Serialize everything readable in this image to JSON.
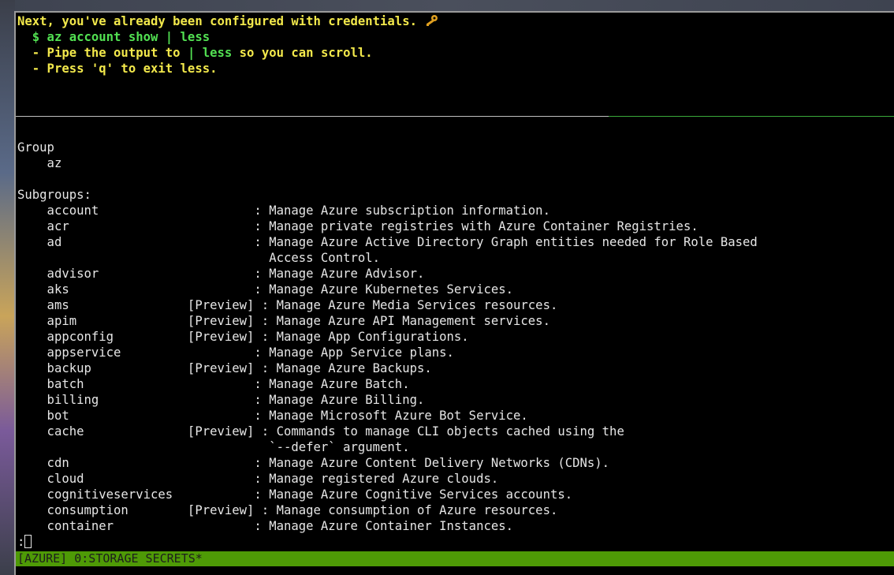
{
  "instructions": {
    "line1": "Next, you've already been configured with credentials.",
    "command": "  $ az account show | less",
    "note1_prefix": "  - Pipe the output to ",
    "note1_highlight": "| less",
    "note1_suffix": " so you can scroll.",
    "note2": "  - Press 'q' to exit less.",
    "line1_icon": "key-icon"
  },
  "help": {
    "group_header": "Group",
    "group_name": "    az",
    "subgroups_header": "Subgroups:",
    "rows": [
      "    account                     : Manage Azure subscription information.",
      "    acr                         : Manage private registries with Azure Container Registries.",
      "    ad                          : Manage Azure Active Directory Graph entities needed for Role Based",
      "                                  Access Control.",
      "    advisor                     : Manage Azure Advisor.",
      "    aks                         : Manage Azure Kubernetes Services.",
      "    ams                [Preview] : Manage Azure Media Services resources.",
      "    apim               [Preview] : Manage Azure API Management services.",
      "    appconfig          [Preview] : Manage App Configurations.",
      "    appservice                  : Manage App Service plans.",
      "    backup             [Preview] : Manage Azure Backups.",
      "    batch                       : Manage Azure Batch.",
      "    billing                     : Manage Azure Billing.",
      "    bot                         : Manage Microsoft Azure Bot Service.",
      "    cache              [Preview] : Commands to manage CLI objects cached using the",
      "                                  `--defer` argument.",
      "    cdn                         : Manage Azure Content Delivery Networks (CDNs).",
      "    cloud                       : Manage registered Azure clouds.",
      "    cognitiveservices           : Manage Azure Cognitive Services accounts.",
      "    consumption        [Preview] : Manage consumption of Azure resources.",
      "    container                   : Manage Azure Container Instances."
    ],
    "prompt": ":"
  },
  "status_bar": {
    "text": "[AZURE] 0:STORAGE SECRETS*"
  },
  "colors": {
    "yellow_text": "#f2e84b",
    "green_text": "#52e052",
    "status_bar_bg": "#4e9a06",
    "terminal_bg": "#000000"
  }
}
